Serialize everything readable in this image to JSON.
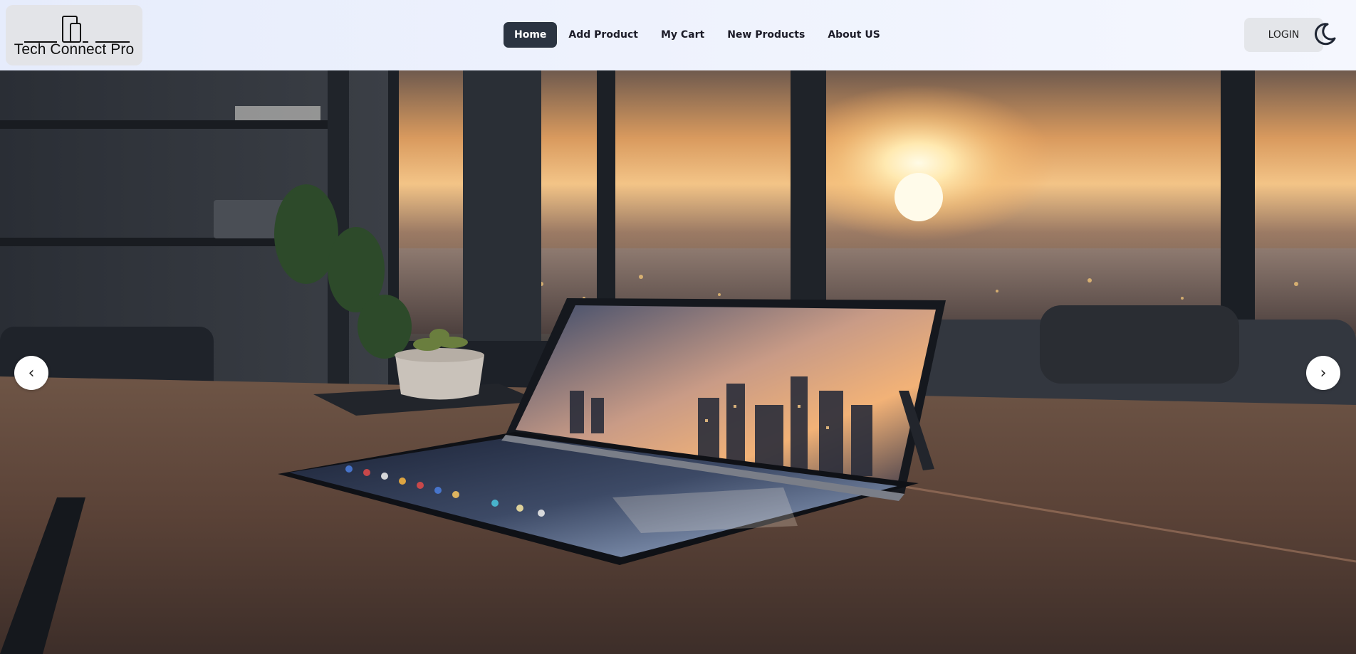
{
  "brand": {
    "name": "Tech Connect Pro",
    "icon": "devices-logo-icon"
  },
  "nav": {
    "items": [
      {
        "label": "Home",
        "active": true
      },
      {
        "label": "Add Product",
        "active": false
      },
      {
        "label": "My Cart",
        "active": false
      },
      {
        "label": "New Products",
        "active": false
      },
      {
        "label": "About US",
        "active": false
      }
    ]
  },
  "auth": {
    "login_label": "LOGIN"
  },
  "theme_toggle": {
    "icon": "moon-icon"
  },
  "carousel": {
    "slide_image": "foldable-tablet-on-desk-at-sunset",
    "prev_icon": "chevron-left-icon",
    "prev_label": "‹",
    "next_icon": "chevron-right-icon",
    "next_label": "›"
  },
  "colors": {
    "navbar_bg": "#e6ecfc",
    "active_nav_bg": "#2b3441",
    "active_nav_text": "#ffffff",
    "login_bg": "#e4e6ea"
  }
}
